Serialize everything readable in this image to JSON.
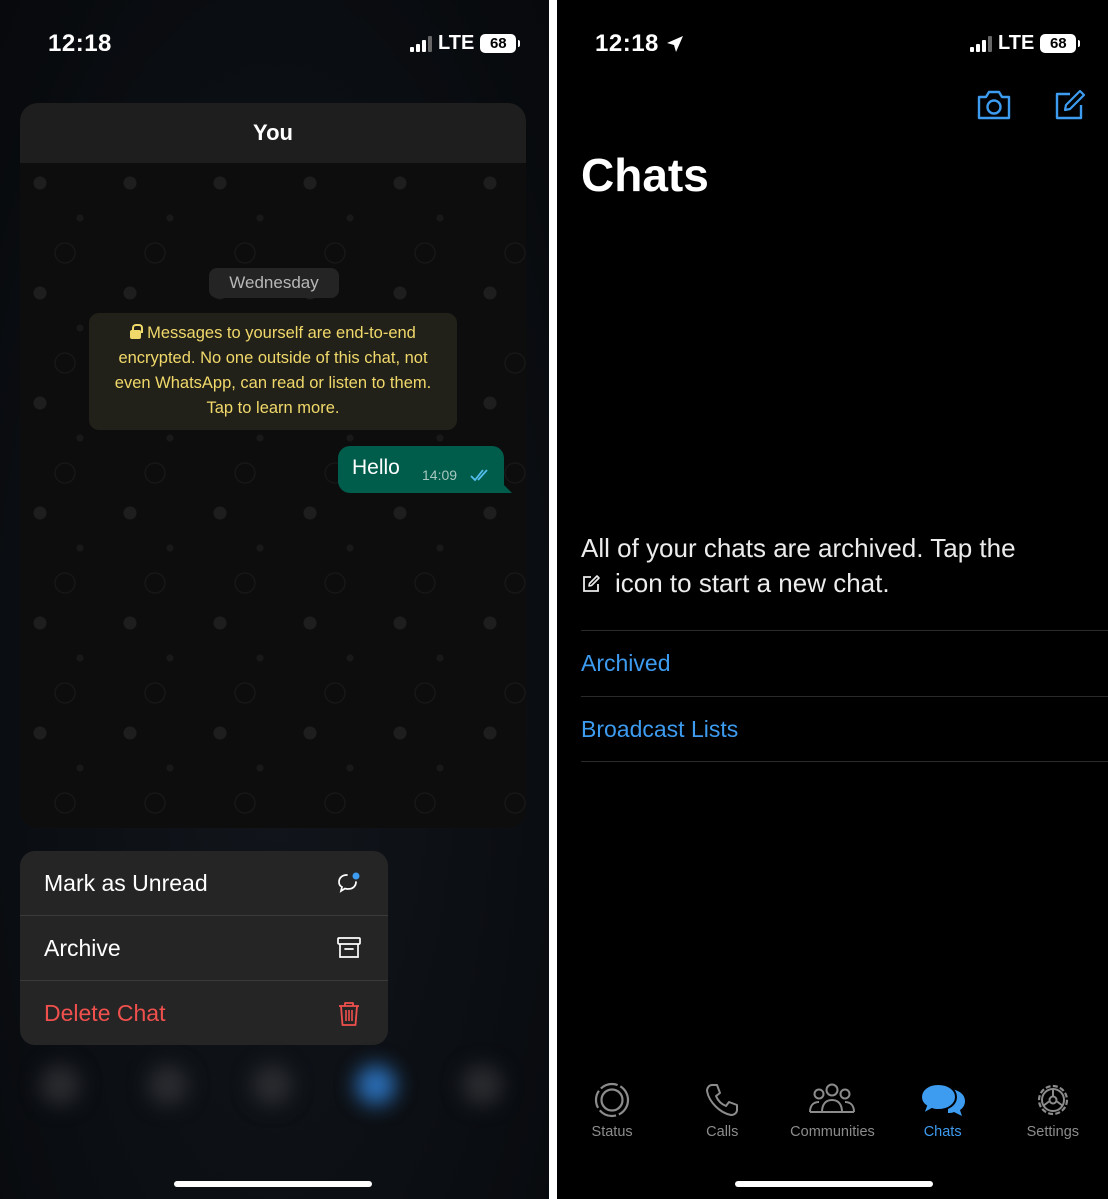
{
  "left": {
    "status": {
      "time": "12:18",
      "network": "LTE",
      "battery": "68"
    },
    "chat_preview": {
      "contact": "You",
      "date_label": "Wednesday",
      "encryption_notice": "Messages to yourself are end-to-end encrypted. No one outside of this chat, not even WhatsApp, can read or listen to them. Tap to learn more.",
      "message": {
        "text": "Hello",
        "time": "14:09",
        "status": "read"
      }
    },
    "context_menu": {
      "items": [
        {
          "label": "Mark as Unread",
          "icon": "chat-unread-icon"
        },
        {
          "label": "Archive",
          "icon": "archive-box-icon"
        },
        {
          "label": "Delete Chat",
          "icon": "trash-icon"
        }
      ]
    }
  },
  "right": {
    "status": {
      "time": "12:18",
      "network": "LTE",
      "battery": "68"
    },
    "header": {
      "title": "Chats"
    },
    "empty_state": {
      "line_before_icon": "All of your chats are archived. Tap the",
      "line_after_icon": "icon to start a new chat."
    },
    "links": {
      "archived": "Archived",
      "broadcast": "Broadcast Lists"
    },
    "tabs": [
      {
        "label": "Status",
        "icon": "status-ring-icon"
      },
      {
        "label": "Calls",
        "icon": "phone-icon"
      },
      {
        "label": "Communities",
        "icon": "communities-icon"
      },
      {
        "label": "Chats",
        "icon": "chat-bubbles-icon",
        "active": true
      },
      {
        "label": "Settings",
        "icon": "gear-icon"
      }
    ]
  },
  "colors": {
    "accent": "#3d9bf0",
    "bubble": "#005c4b",
    "danger": "#f0504d",
    "notice": "#f0d86a"
  }
}
